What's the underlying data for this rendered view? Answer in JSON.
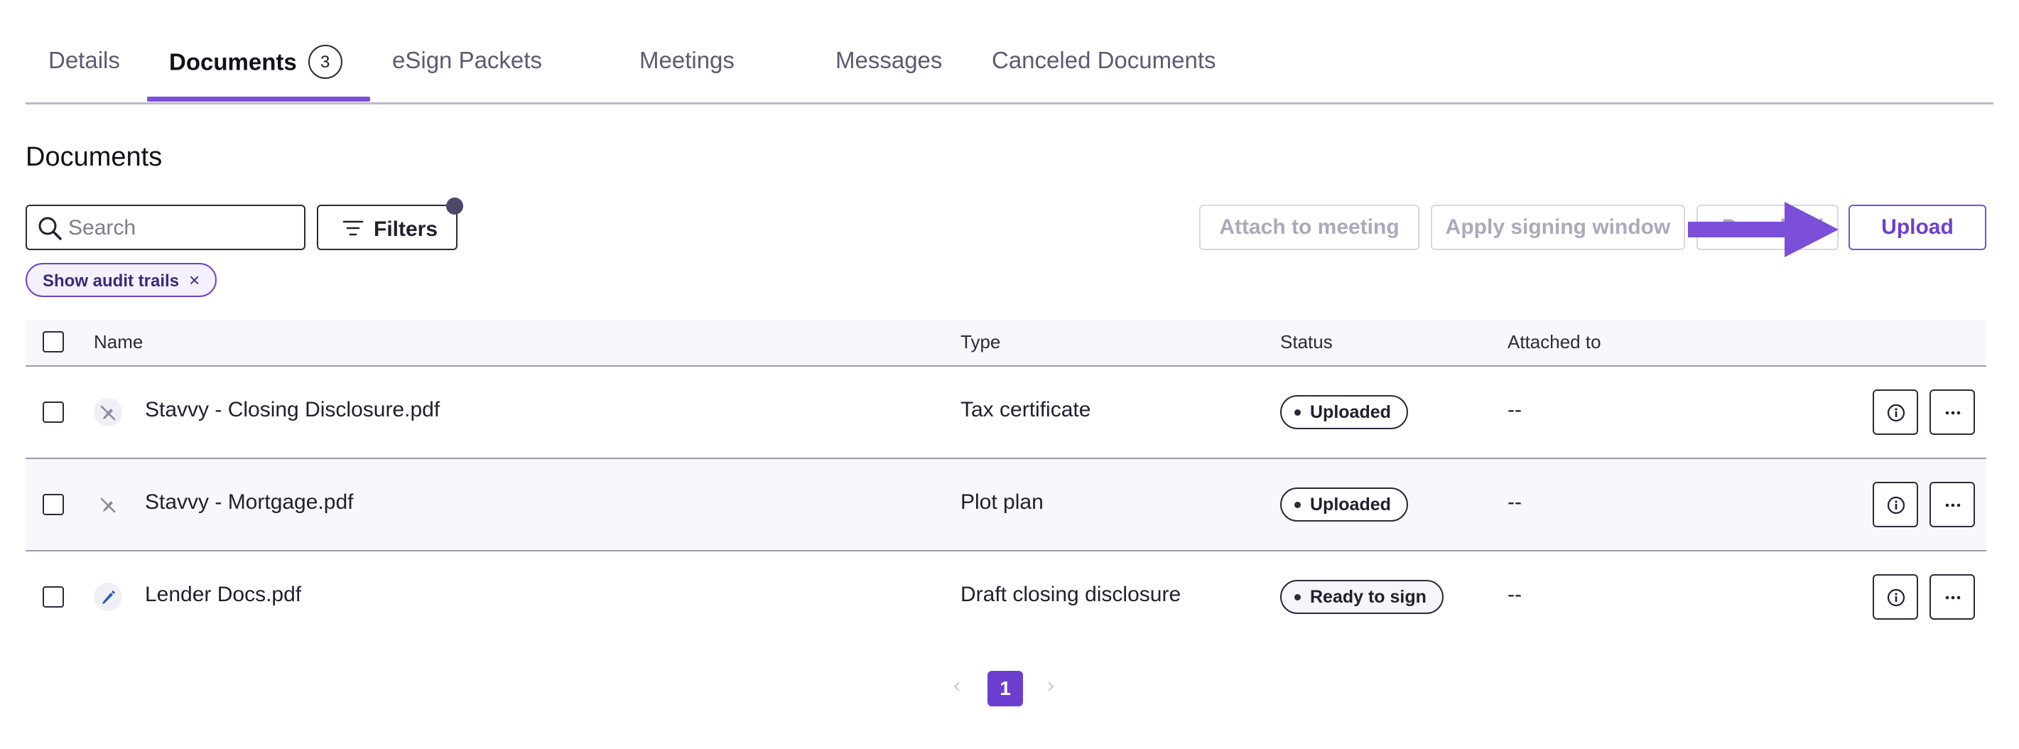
{
  "tabs": [
    {
      "label": "Details"
    },
    {
      "label": "Documents",
      "badge": "3",
      "active": true
    },
    {
      "label": "eSign Packets"
    },
    {
      "label": "Meetings"
    },
    {
      "label": "Messages"
    },
    {
      "label": "Canceled Documents"
    }
  ],
  "section_title": "Documents",
  "search": {
    "placeholder": "Search",
    "value": ""
  },
  "filters": {
    "label": "Filters"
  },
  "toolbar": {
    "attach_label": "Attach to meeting",
    "signing_window_label": "Apply signing window",
    "download_label": "Download",
    "upload_label": "Upload"
  },
  "active_filter_chip": {
    "label": "Show audit trails",
    "close": "×"
  },
  "table": {
    "columns": {
      "name": "Name",
      "type": "Type",
      "status": "Status",
      "attached_to": "Attached to"
    },
    "rows": [
      {
        "name": "Stavvy - Closing Disclosure.pdf",
        "type": "Tax certificate",
        "status": "Uploaded",
        "attached_to": "--",
        "icon": "pencil-off-icon"
      },
      {
        "name": "Stavvy - Mortgage.pdf",
        "type": "Plot plan",
        "status": "Uploaded",
        "attached_to": "--",
        "icon": "pencil-off-icon"
      },
      {
        "name": "Lender Docs.pdf",
        "type": "Draft closing disclosure",
        "status": "Ready to sign",
        "attached_to": "--",
        "icon": "pencil-icon"
      }
    ]
  },
  "pagination": {
    "prev": "‹",
    "current": "1",
    "next": "›"
  },
  "colors": {
    "accent": "#6d3fd0",
    "arrow": "#7b4fd8",
    "pencil_active": "#2f56b0",
    "pencil_off": "#8a8b9c"
  }
}
